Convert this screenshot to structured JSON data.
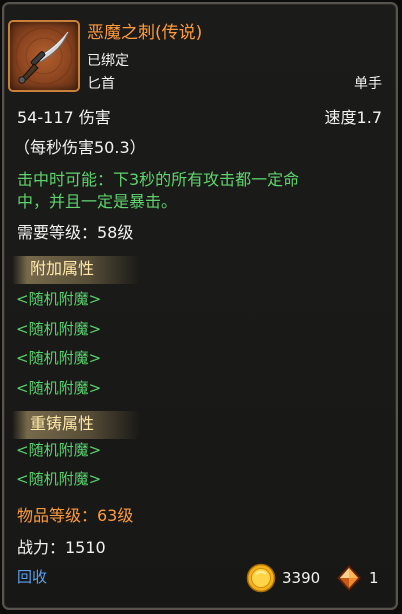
{
  "item": {
    "name": "恶魔之刺(传说)",
    "bind_status": "已绑定",
    "type": "匕首",
    "hand": "单手",
    "damage": "54-117 伤害",
    "speed": "速度1.7",
    "dps": "（每秒伤害50.3）",
    "effect_line1": "击中时可能：下3秒的所有攻击都一定命",
    "effect_line2": "中，并且一定是暴击。",
    "required_level": "需要等级：58级",
    "bonus_section_title": "附加属性",
    "bonus_attributes": [
      "<随机附魔>",
      "<随机附魔>",
      "<随机附魔>",
      "<随机附魔>"
    ],
    "reforge_section_title": "重铸属性",
    "reforge_attributes": [
      "<随机附魔>",
      "<随机附魔>"
    ],
    "item_level": "物品等级：63级",
    "power": "战力：1510",
    "icon": "dagger-icon"
  },
  "footer": {
    "recycle_label": "回收",
    "gold_amount": "3390",
    "gold_icon": "gold-coin-icon",
    "gem_amount": "1",
    "gem_icon": "orange-gem-icon"
  },
  "colors": {
    "legendary": "#ff9b3d",
    "enchant": "#58d16e",
    "effect": "#5fd36d",
    "text": "#f2f2f2",
    "section_title": "#ffe9a8",
    "recycle": "#5aa0ee"
  }
}
